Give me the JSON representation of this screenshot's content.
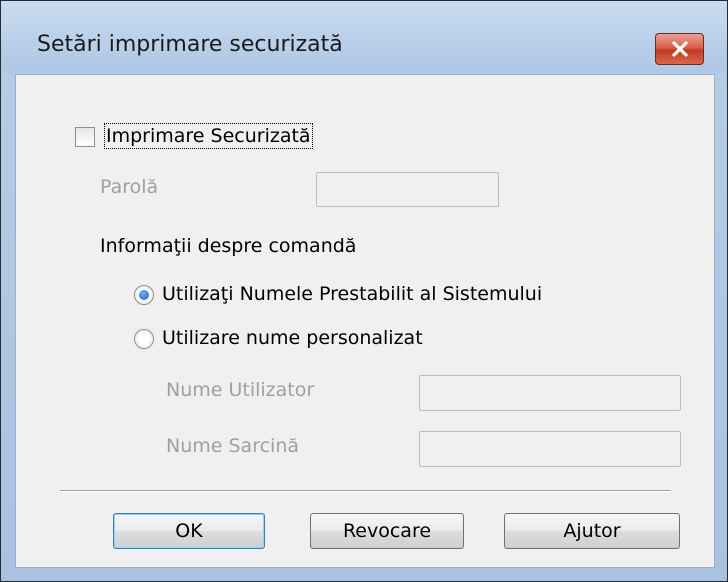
{
  "dialog": {
    "title": "Setări imprimare securizată",
    "close_icon": "close-x-icon"
  },
  "secure_print": {
    "checkbox_label": "Imprimare Securizată",
    "checked": false,
    "password_label": "Parolă",
    "password_value": ""
  },
  "job_info": {
    "heading": "Informaţii despre comandă",
    "options": [
      {
        "label": "Utilizaţi Numele Prestabilit al Sistemului",
        "selected": true
      },
      {
        "label": "Utilizare nume personalizat",
        "selected": false
      }
    ],
    "user_name_label": "Nume Utilizator",
    "user_name_value": "",
    "job_name_label": "Nume Sarcină",
    "job_name_value": ""
  },
  "buttons": {
    "ok": "OK",
    "cancel": "Revocare",
    "help": "Ajutor"
  },
  "colors": {
    "close_button": "#d9614b",
    "radio_selected": "#1b5fb4"
  }
}
